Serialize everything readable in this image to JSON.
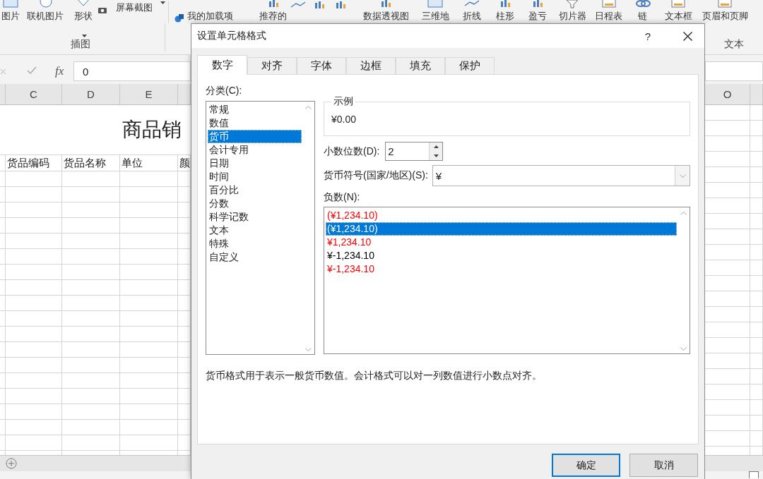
{
  "ribbon": {
    "top_left": [
      {
        "label": "图片"
      },
      {
        "label": "联机图片"
      },
      {
        "label": "形状"
      }
    ],
    "screenshot": "屏幕截图",
    "addins": "我的加载项",
    "top_right": [
      {
        "label": "推荐的"
      },
      {
        "label": "数据透视图"
      },
      {
        "label": "三维地"
      },
      {
        "label": "折线"
      },
      {
        "label": "柱形"
      },
      {
        "label": "盈亏"
      },
      {
        "label": "切片器"
      },
      {
        "label": "日程表"
      },
      {
        "label": "链"
      },
      {
        "label": "文本框"
      },
      {
        "label": "页眉和页脚"
      }
    ],
    "group_left": "插图",
    "group_right": "文本"
  },
  "formula_bar": {
    "fx": "fx",
    "value": "0"
  },
  "sheet": {
    "columns_left": [
      "C",
      "D",
      "E"
    ],
    "columns_right": [
      "O"
    ],
    "title": "商品销",
    "headers": [
      "货品编码",
      "货品名称",
      "单位",
      "颜"
    ]
  },
  "dialog": {
    "title": "设置单元格格式",
    "help": "?",
    "tabs": [
      {
        "label": "数字",
        "selected": true
      },
      {
        "label": "对齐",
        "selected": false
      },
      {
        "label": "字体",
        "selected": false
      },
      {
        "label": "边框",
        "selected": false
      },
      {
        "label": "填充",
        "selected": false
      },
      {
        "label": "保护",
        "selected": false
      }
    ],
    "category_label": "分类(C):",
    "categories": [
      {
        "label": "常规",
        "selected": false
      },
      {
        "label": "数值",
        "selected": false
      },
      {
        "label": "货币",
        "selected": true
      },
      {
        "label": "会计专用",
        "selected": false
      },
      {
        "label": "日期",
        "selected": false
      },
      {
        "label": "时间",
        "selected": false
      },
      {
        "label": "百分比",
        "selected": false
      },
      {
        "label": "分数",
        "selected": false
      },
      {
        "label": "科学记数",
        "selected": false
      },
      {
        "label": "文本",
        "selected": false
      },
      {
        "label": "特殊",
        "selected": false
      },
      {
        "label": "自定义",
        "selected": false
      }
    ],
    "sample_label": "示例",
    "sample_value": "¥0.00",
    "decimal_label": "小数位数(D):",
    "decimal_value": "2",
    "symbol_label": "货币符号(国家/地区)(S):",
    "symbol_value": "¥",
    "negative_label": "负数(N):",
    "negatives": [
      {
        "label": "(¥1,234.10)",
        "color": "#ff0000",
        "selected": false
      },
      {
        "label": "(¥1,234.10)",
        "selected": true
      },
      {
        "label": "¥1,234.10",
        "color": "#ff0000",
        "selected": false
      },
      {
        "label": "¥-1,234.10",
        "color": "#000000",
        "selected": false
      },
      {
        "label": "¥-1,234.10",
        "color": "#ff0000",
        "selected": false
      }
    ],
    "description": "货币格式用于表示一般货币数值。会计格式可以对一列数值进行小数点对齐。",
    "buttons": [
      {
        "label": "确定",
        "default": true
      },
      {
        "label": "取消",
        "default": false
      }
    ]
  }
}
